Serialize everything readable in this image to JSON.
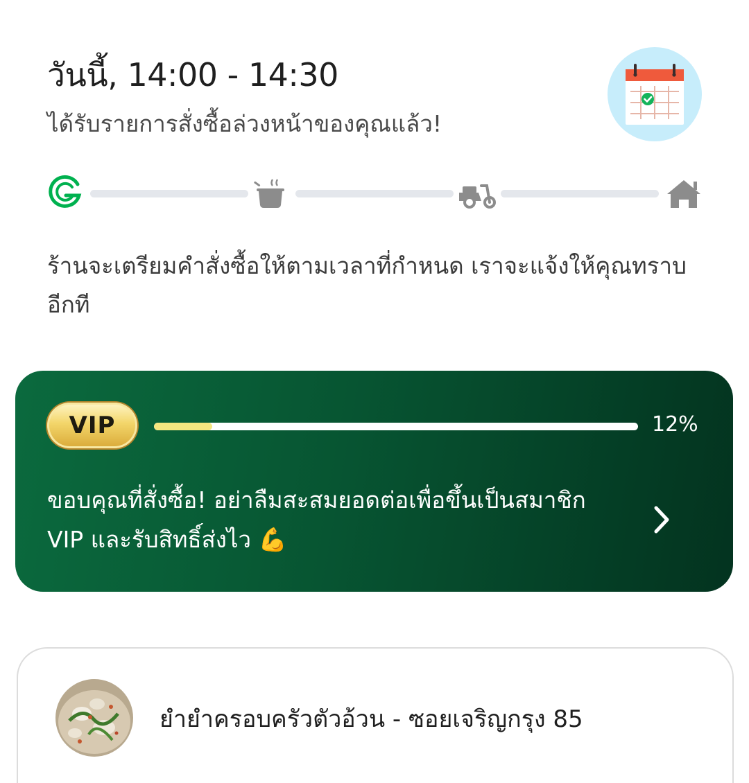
{
  "order_status": {
    "schedule_title": "วันนี้, 14:00 - 14:30",
    "subtitle": "ได้รับรายการสั่งซื้อล่วงหน้าของคุณแล้ว!",
    "info_text": "ร้านจะเตรียมคำสั่งซื้อให้ตามเวลาที่กำหนด เราจะแจ้งให้คุณทราบอีกที",
    "tracker_steps": [
      "grab-logo-icon",
      "cooking-pot-icon",
      "delivery-scooter-icon",
      "home-icon"
    ],
    "colors": {
      "grab_green": "#00b14f",
      "inactive_gray": "#8c8c8c",
      "track_gray": "#e4e7ec"
    }
  },
  "vip": {
    "badge_label": "VIP",
    "progress": 0.12,
    "percent_label": "12%",
    "message": "ขอบคุณที่สั่งซื้อ! อย่าลืมสะสมยอดต่อเพื่อขึ้นเป็นสมาชิก VIP และรับสิทธิ์ส่งไว 💪",
    "colors": {
      "card_start": "#0b6a3e",
      "card_end": "#03331f",
      "progress_fill": "#f5e780"
    }
  },
  "restaurant": {
    "name": "ยำยำครอบครัวตัวอ้วน - ซอยเจริญกรุง 85"
  }
}
